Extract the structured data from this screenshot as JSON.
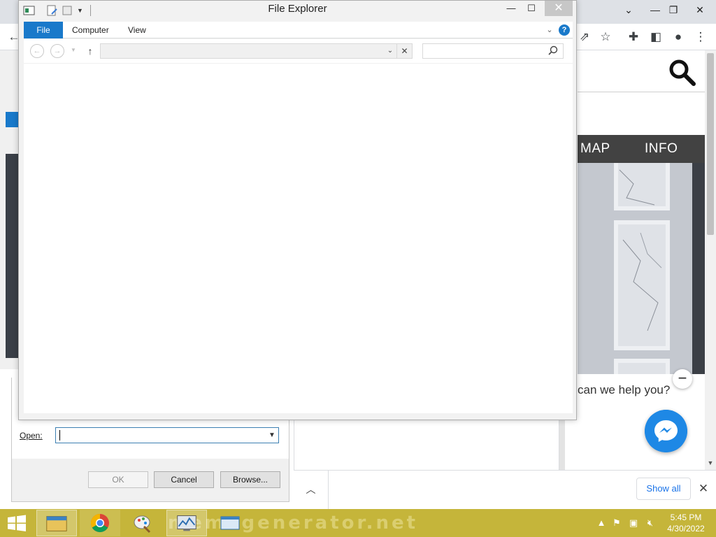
{
  "explorer": {
    "title": "File Explorer",
    "ribbon_tabs": [
      "File",
      "Computer",
      "View"
    ],
    "address_value": "",
    "search_placeholder": ""
  },
  "run_dialog": {
    "open_label": "Open:",
    "open_value": "",
    "buttons": {
      "ok": "OK",
      "cancel": "Cancel",
      "browse": "Browse..."
    }
  },
  "browser": {
    "site_nav": [
      "MAP",
      "INFO"
    ],
    "chat_prompt": "can we help you?",
    "downloads": {
      "show_all": "Show all"
    },
    "controls": {
      "minimize": "—",
      "restore": "❐",
      "close": "✕"
    }
  },
  "taskbar": {
    "time": "5:45 PM",
    "date": "4/30/2022",
    "wallpaper_text": "memegenerator.net"
  },
  "colors": {
    "accent_blue": "#1979ca",
    "taskbar": "#c5b53a",
    "nav_dark": "#424242",
    "messenger": "#1e88e5"
  }
}
